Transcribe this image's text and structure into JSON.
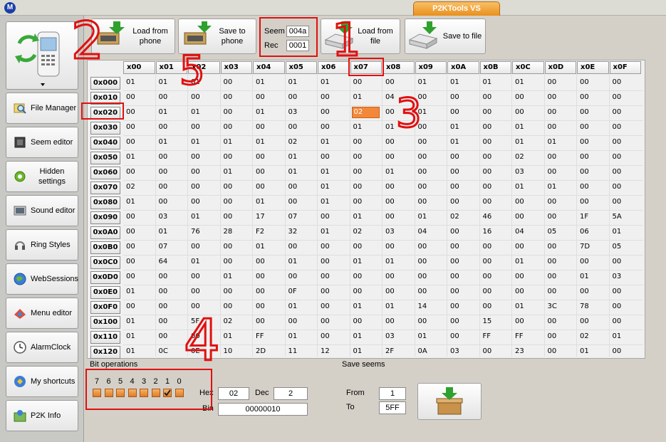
{
  "window": {
    "title": "P2KTools VS",
    "logo": "M"
  },
  "sidebar": {
    "items": [
      {
        "label": "File Manager",
        "icon": "magnifier-icon"
      },
      {
        "label": "Seem editor",
        "icon": "chip-icon"
      },
      {
        "label": "Hidden settings",
        "icon": "gear-icon"
      },
      {
        "label": "Sound editor",
        "icon": "speaker-icon"
      },
      {
        "label": "Ring Styles",
        "icon": "headphones-icon"
      },
      {
        "label": "WebSessions",
        "icon": "globe-icon"
      },
      {
        "label": "Menu editor",
        "icon": "menu-icon"
      },
      {
        "label": "AlarmClock",
        "icon": "clock-icon"
      },
      {
        "label": "My shortcuts",
        "icon": "shortcuts-icon"
      },
      {
        "label": "P2K Info",
        "icon": "info-icon"
      }
    ]
  },
  "toolbar": {
    "load_from_phone": "Load from phone",
    "save_to_phone": "Save to phone",
    "seem_label": "Seem",
    "seem_value": "004a",
    "rec_label": "Rec",
    "rec_value": "0001",
    "load_from_file": "Load from file",
    "save_to_file": "Save to file"
  },
  "grid": {
    "columns": [
      "x00",
      "x01",
      "x02",
      "x03",
      "x04",
      "x05",
      "x06",
      "x07",
      "x08",
      "x09",
      "x0A",
      "x0B",
      "x0C",
      "x0D",
      "x0E",
      "x0F"
    ],
    "rows": [
      {
        "addr": "0x000",
        "cells": [
          "01",
          "01",
          "01",
          "00",
          "01",
          "01",
          "01",
          "00",
          "00",
          "01",
          "01",
          "01",
          "01",
          "00",
          "00",
          "00"
        ]
      },
      {
        "addr": "0x010",
        "cells": [
          "00",
          "00",
          "00",
          "00",
          "00",
          "00",
          "00",
          "01",
          "04",
          "00",
          "00",
          "00",
          "00",
          "00",
          "00",
          "00"
        ]
      },
      {
        "addr": "0x020",
        "cells": [
          "00",
          "01",
          "01",
          "00",
          "01",
          "03",
          "00",
          "02",
          "00",
          "01",
          "00",
          "00",
          "00",
          "00",
          "00",
          "00"
        ]
      },
      {
        "addr": "0x030",
        "cells": [
          "00",
          "00",
          "00",
          "00",
          "00",
          "00",
          "00",
          "01",
          "01",
          "00",
          "01",
          "00",
          "01",
          "00",
          "00",
          "00"
        ]
      },
      {
        "addr": "0x040",
        "cells": [
          "00",
          "01",
          "01",
          "01",
          "01",
          "02",
          "01",
          "00",
          "00",
          "00",
          "01",
          "00",
          "01",
          "01",
          "00",
          "00"
        ]
      },
      {
        "addr": "0x050",
        "cells": [
          "01",
          "00",
          "00",
          "00",
          "00",
          "01",
          "00",
          "00",
          "00",
          "00",
          "00",
          "00",
          "02",
          "00",
          "00",
          "00"
        ]
      },
      {
        "addr": "0x060",
        "cells": [
          "00",
          "00",
          "00",
          "01",
          "00",
          "01",
          "01",
          "00",
          "01",
          "00",
          "00",
          "00",
          "03",
          "00",
          "00",
          "00"
        ]
      },
      {
        "addr": "0x070",
        "cells": [
          "02",
          "00",
          "00",
          "00",
          "00",
          "00",
          "01",
          "00",
          "00",
          "00",
          "00",
          "00",
          "01",
          "01",
          "00",
          "00"
        ]
      },
      {
        "addr": "0x080",
        "cells": [
          "01",
          "00",
          "00",
          "00",
          "01",
          "00",
          "01",
          "00",
          "00",
          "00",
          "00",
          "00",
          "00",
          "00",
          "00",
          "00"
        ]
      },
      {
        "addr": "0x090",
        "cells": [
          "00",
          "03",
          "01",
          "00",
          "17",
          "07",
          "00",
          "01",
          "00",
          "01",
          "02",
          "46",
          "00",
          "00",
          "1F",
          "5A"
        ]
      },
      {
        "addr": "0x0A0",
        "cells": [
          "00",
          "01",
          "76",
          "28",
          "F2",
          "32",
          "01",
          "02",
          "03",
          "04",
          "00",
          "16",
          "04",
          "05",
          "06",
          "01"
        ]
      },
      {
        "addr": "0x0B0",
        "cells": [
          "00",
          "07",
          "00",
          "00",
          "01",
          "00",
          "00",
          "00",
          "00",
          "00",
          "00",
          "00",
          "00",
          "00",
          "7D",
          "05"
        ]
      },
      {
        "addr": "0x0C0",
        "cells": [
          "00",
          "64",
          "01",
          "00",
          "00",
          "01",
          "00",
          "01",
          "01",
          "00",
          "00",
          "00",
          "01",
          "00",
          "00",
          "00"
        ]
      },
      {
        "addr": "0x0D0",
        "cells": [
          "00",
          "00",
          "00",
          "01",
          "00",
          "00",
          "00",
          "00",
          "00",
          "00",
          "00",
          "00",
          "00",
          "00",
          "01",
          "03"
        ]
      },
      {
        "addr": "0x0E0",
        "cells": [
          "01",
          "00",
          "00",
          "00",
          "00",
          "0F",
          "00",
          "00",
          "00",
          "00",
          "00",
          "00",
          "00",
          "00",
          "00",
          "00"
        ]
      },
      {
        "addr": "0x0F0",
        "cells": [
          "00",
          "00",
          "00",
          "00",
          "00",
          "01",
          "00",
          "01",
          "01",
          "14",
          "00",
          "00",
          "01",
          "3C",
          "78",
          "00"
        ]
      },
      {
        "addr": "0x100",
        "cells": [
          "01",
          "00",
          "5F",
          "02",
          "00",
          "00",
          "00",
          "00",
          "00",
          "00",
          "00",
          "15",
          "00",
          "00",
          "00",
          "00"
        ]
      },
      {
        "addr": "0x110",
        "cells": [
          "01",
          "00",
          "00",
          "01",
          "FF",
          "01",
          "00",
          "01",
          "03",
          "01",
          "00",
          "FF",
          "FF",
          "00",
          "02",
          "01"
        ]
      },
      {
        "addr": "0x120",
        "cells": [
          "01",
          "0C",
          "0E",
          "10",
          "2D",
          "11",
          "12",
          "01",
          "2F",
          "0A",
          "03",
          "00",
          "23",
          "00",
          "01",
          "00"
        ]
      }
    ],
    "selected": {
      "row": 2,
      "col": 7
    }
  },
  "bit_ops": {
    "title": "Bit operations",
    "bits": [
      "7",
      "6",
      "5",
      "4",
      "3",
      "2",
      "1",
      "0"
    ],
    "checked_bit": "1",
    "hex_label": "Hex",
    "hex_value": "02",
    "dec_label": "Dec",
    "dec_value": "2",
    "bin_label": "Bin",
    "bin_value": "00000010"
  },
  "save_seems": {
    "title": "Save seems",
    "from_label": "From",
    "from_value": "1",
    "to_label": "To",
    "to_value": "5FF"
  },
  "annotations": {
    "n1": "1",
    "n2": "2",
    "n3": "3",
    "n4": "4",
    "n5": "5"
  },
  "colors": {
    "accent": "#f3883a",
    "annotation": "#e01010"
  }
}
